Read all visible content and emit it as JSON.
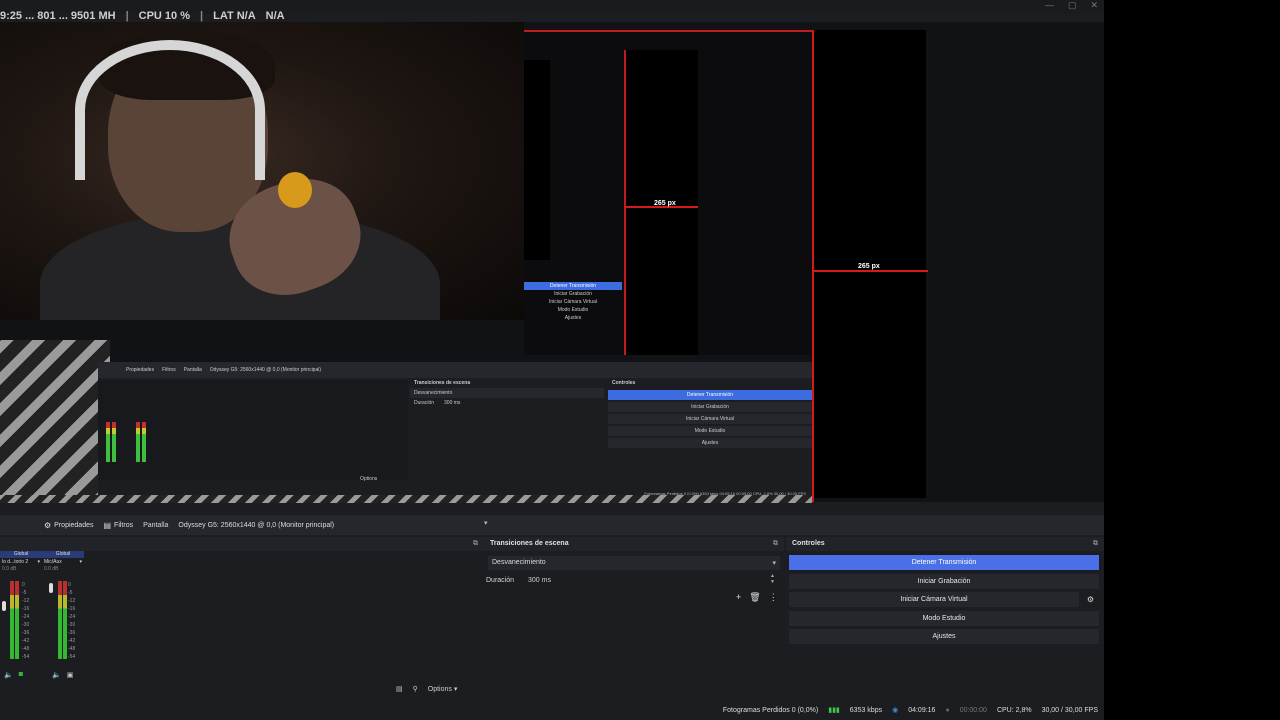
{
  "stats_overlay": {
    "garbled": "9:25 ... 801 ... 9501 MH",
    "cpu": "CPU 10 %",
    "lat": "LAT N/A",
    "lat_value": "N/A"
  },
  "preview": {
    "px_label_small": "265 px",
    "px_label_large": "265 px"
  },
  "nested": {
    "controls": [
      "Detener Transmisión",
      "Iniciar Grabación",
      "Iniciar Cámara Virtual",
      "Modo Estudio",
      "Ajustes"
    ],
    "tabs": [
      "Propiedades",
      "Filtros",
      "Pantalla",
      "Odyssey G5: 2560x1440 @ 0,0 (Monitor principal)"
    ],
    "trans_header": "Transiciones de escena",
    "ctrl_header": "Controles",
    "trans_value": "Desvanecimiento",
    "duration_label": "Duración",
    "duration_value": "300 ms",
    "options": "Options",
    "status": "Fotogramas Perdidos 0 (0,0%)   6353 kbps   04:09:16   00:00:00   CPU: 2,8%   30,00 / 30,00 FPS"
  },
  "toolbar": {
    "properties": "Propiedades",
    "filters": "Filtros",
    "source_type": "Pantalla",
    "source_name": "Odyssey G5: 2560x1440 @ 0,0 (Monitor principal)"
  },
  "mixer": {
    "ch1_header": "Global",
    "ch1_name": "lo d...torio 2",
    "ch1_db": "0.0 dB",
    "ch2_header": "Global",
    "ch2_name": "Mic/Aux",
    "ch2_db": "0.0 dB",
    "scale": [
      "0",
      "-5",
      "-12",
      "-16",
      "-24",
      "-30",
      "-36",
      "-42",
      "-48",
      "-54",
      "-60"
    ],
    "options": "Options"
  },
  "transitions": {
    "title": "Transiciones de escena",
    "value": "Desvanecimiento",
    "duration_label": "Duración",
    "duration_value": "300 ms"
  },
  "controls": {
    "title": "Controles",
    "stop_stream": "Detener Transmisión",
    "start_record": "Iniciar Grabación",
    "start_virtual_cam": "Iniciar Cámara Virtual",
    "studio_mode": "Modo Estudio",
    "settings": "Ajustes"
  },
  "status": {
    "dropped": "Fotogramas Perdidos 0 (0,0%)",
    "bitrate": "6353 kbps",
    "stream_time": "04:09:16",
    "rec_time": "00:00:00",
    "cpu": "CPU: 2,8%",
    "fps": "30,00 / 30,00 FPS"
  },
  "colors": {
    "accent": "#4a6fe6",
    "red_guide": "#d51a1a",
    "panel": "#1c1d21"
  }
}
